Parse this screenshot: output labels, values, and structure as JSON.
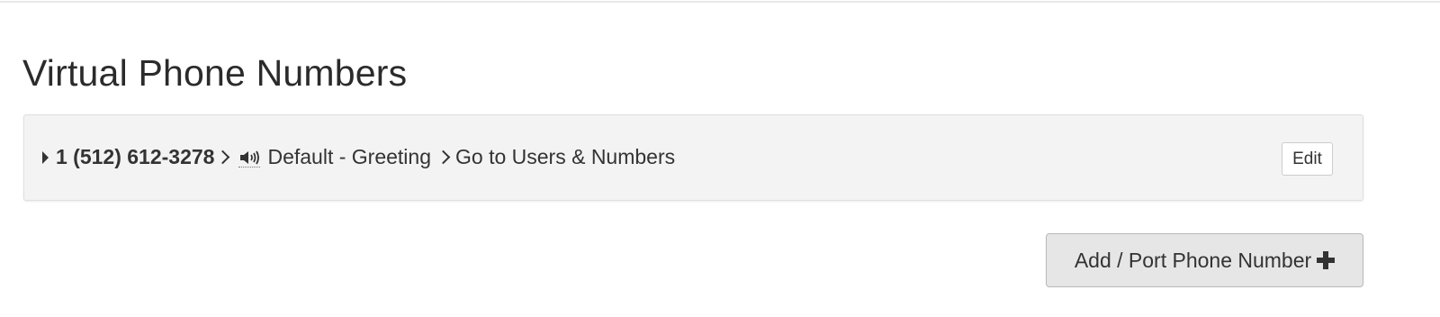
{
  "page": {
    "title": "Virtual Phone Numbers"
  },
  "numbers": [
    {
      "number": "1 (512) 612-3278",
      "greeting": "Default - Greeting",
      "destination": "Go to Users & Numbers",
      "edit_label": "Edit",
      "icons": [
        "caret-right-icon",
        "chevron-right-icon",
        "speaker-icon",
        "chevron-right-icon"
      ]
    }
  ],
  "actions": {
    "add_port_label": "Add / Port Phone Number",
    "add_port_icon": "plus-icon"
  },
  "colors": {
    "panel_bg": "#f3f3f3",
    "button_bg": "#e6e6e6",
    "text": "#333333"
  }
}
